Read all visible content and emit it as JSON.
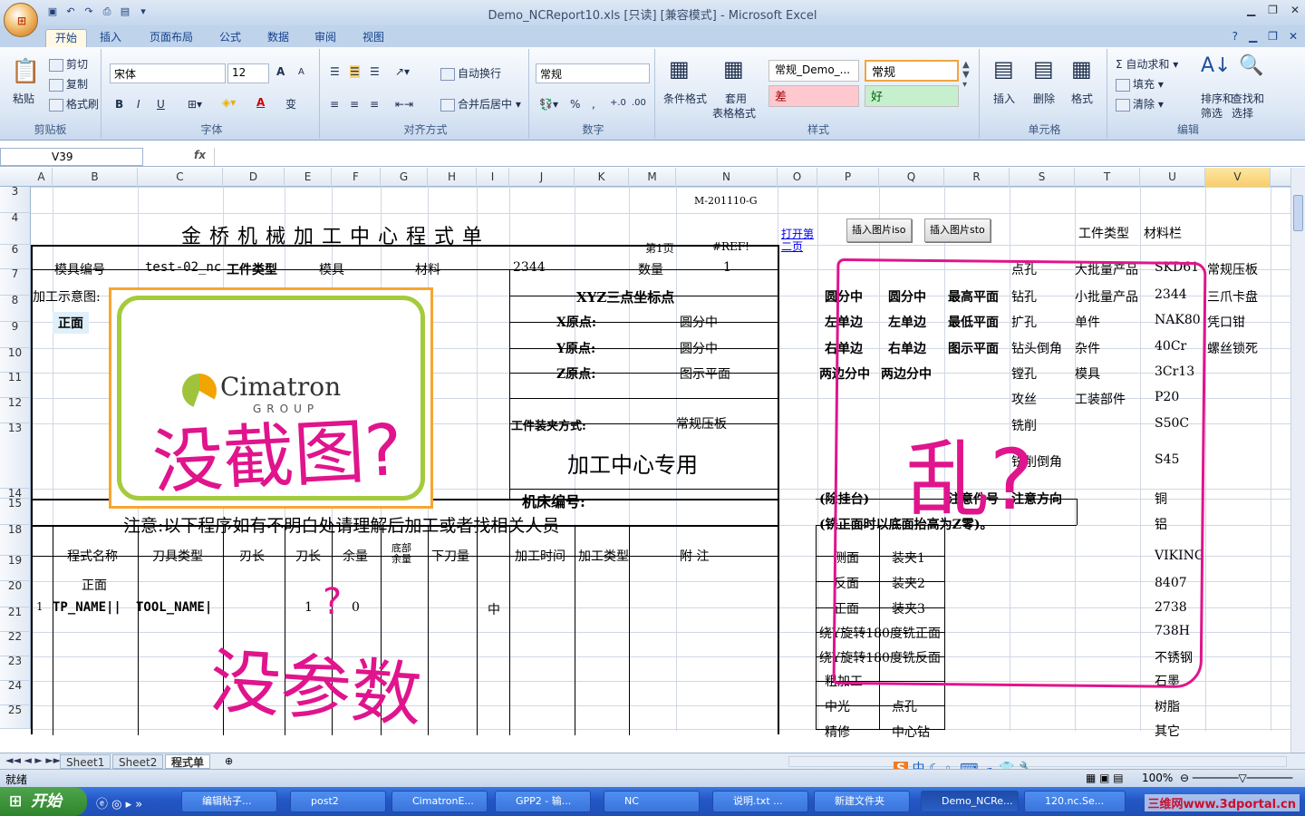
{
  "window": {
    "title": "Demo_NCReport10.xls  [只读]  [兼容模式] - Microsoft Excel",
    "office_button": "⊞"
  },
  "tabs": [
    "开始",
    "插入",
    "页面布局",
    "公式",
    "数据",
    "审阅",
    "视图"
  ],
  "ribbon": {
    "clipboard": {
      "label": "剪贴板",
      "paste": "粘贴",
      "cut": "剪切",
      "copy": "复制",
      "format_painter": "格式刷"
    },
    "font": {
      "label": "字体",
      "family": "宋体",
      "size": "12",
      "bold": "B",
      "italic": "I",
      "underline": "U",
      "grow": "A",
      "shrink": "A",
      "fontcolor": "A",
      "phonetic": "变"
    },
    "align": {
      "label": "对齐方式",
      "wrap": "自动换行",
      "merge": "合并后居中"
    },
    "number": {
      "label": "数字",
      "format": "常规",
      "percent": "%",
      "comma": ",",
      "inc": "+.0",
      "dec": ".00"
    },
    "styles": {
      "label": "样式",
      "cond": "条件格式",
      "table_fmt": "套用",
      "table_fmt2": "表格格式",
      "normal_demo": "常规_Demo_...",
      "normal": "常规",
      "bad": "差",
      "good": "好"
    },
    "cells": {
      "label": "单元格",
      "insert": "插入",
      "delete": "删除",
      "format": "格式"
    },
    "editing": {
      "label": "编辑",
      "autosum": "自动求和",
      "fill": "填充",
      "clear": "清除",
      "sort": "排序和",
      "sort2": "筛选",
      "find": "查找和",
      "find2": "选择"
    }
  },
  "formula_bar": {
    "namebox": "V39",
    "fx": "fx",
    "value": ""
  },
  "columns": [
    "A",
    "B",
    "C",
    "D",
    "E",
    "F",
    "G",
    "H",
    "I",
    "J",
    "K",
    "M",
    "N",
    "O",
    "P",
    "Q",
    "R",
    "S",
    "T",
    "U",
    "V"
  ],
  "rows": [
    "3",
    "4",
    "6",
    "7",
    "8",
    "9",
    "10",
    "11",
    "12",
    "13",
    "14",
    "15",
    "18",
    "19",
    "20",
    "21",
    "22",
    "23",
    "24",
    "25"
  ],
  "sheet": {
    "code": "M-201110-G",
    "title": "金 桥 机 械 加 工 中 心 程 式 单",
    "page": "第1页",
    "ref": "#REF!",
    "open_page2": "打开第二页",
    "insert_iso": "插入图片iso",
    "insert_sto": "插入图片sto",
    "part_type_header": "工件类型",
    "material_header": "材料栏",
    "mold_no": "模具编号",
    "mold_no_val": "test-02_nc",
    "part_type": "工件类型",
    "part_type_val": "模具",
    "material": "材料",
    "material_val": "2344",
    "qty": "数量",
    "qty_val": "1",
    "diagram": "加工示意图:",
    "front": "正面",
    "xyz": "XYZ三点坐标点",
    "x_origin": "X原点:",
    "x_val": "圆分中",
    "y_origin": "Y原点:",
    "y_val": "圆分中",
    "z_origin": "Z原点:",
    "z_val": "图示平面",
    "clamp": "工件装夹方式:",
    "clamp_val": "常规压板",
    "center_only": "加工中心专用",
    "machine_no": "机床编号:",
    "notice": "注意:以下程序如有不明白处请理解后加工或者找相关人员",
    "cols_hdr": [
      "程式名称",
      "刀具类型",
      "刃长",
      "刀长",
      "余量",
      "底部余量",
      "下刀量",
      "",
      "加工时间",
      "加工类型",
      "附    注"
    ],
    "row19_front": "正面",
    "row20": {
      "no": "1",
      "name": "TP_NAME||",
      "tool": "TOOL_NAME|",
      "len": "1",
      "stock": "0",
      "mid": "中"
    },
    "logo_main": "Cimatron",
    "logo_sub": "GROUP",
    "list_p": [
      "圆分中",
      "左单边",
      "右单边",
      "两边分中"
    ],
    "list_q": [
      "圆分中",
      "左单边",
      "右单边",
      "两边分中"
    ],
    "list_r": [
      "最高平面",
      "最低平面",
      "图示平面"
    ],
    "list_s": [
      "点孔",
      "钻孔",
      "扩孔",
      "钻头倒角",
      "镗孔",
      "攻丝",
      "铣削",
      "铣削倒角",
      "注意方向"
    ],
    "list_t": [
      "大批量产品",
      "小批量产品",
      "单件",
      "杂件",
      "模具",
      "工装部件"
    ],
    "list_u": [
      "SKD61",
      "2344",
      "NAK80",
      "40Cr",
      "3Cr13",
      "P20",
      "S50C",
      "S45",
      "铜",
      "铝",
      "VIKING",
      "8407",
      "2738",
      "738H",
      "不锈钢",
      "石墨",
      "树脂",
      "其它"
    ],
    "list_v": [
      "常规压板",
      "三爪卡盘",
      "凭口钳",
      "螺丝锁死"
    ],
    "except": "(除挂台)",
    "note_part": "注意件号",
    "front_note": "(铣正面时以底面抬高为Z零)。",
    "side_a": [
      "侧面",
      "反面",
      "正面"
    ],
    "side_b": [
      "装夹1",
      "装夹2",
      "装夹3"
    ],
    "rot1": "绕Y旋转180度铣正面",
    "rot2": "绕Y旋转180度铣反面",
    "ops_a": [
      "粗加工",
      "中光",
      "精修"
    ],
    "ops_b": [
      "",
      "点孔",
      "中心钻"
    ]
  },
  "annotations": {
    "no_screenshot": "没截图?",
    "mess": "乱?",
    "no_param": "没参数",
    "q": "?"
  },
  "sheet_tabs": [
    "Sheet1",
    "Sheet2",
    "程式单"
  ],
  "status": {
    "ready": "就绪",
    "zoom": "100%"
  },
  "ime": "中",
  "taskbar": {
    "start": "开始",
    "items": [
      "编辑帖子...",
      "post2",
      "CimatronE...",
      "GPP2 - 输...",
      "NC",
      "说明.txt ...",
      "新建文件夹",
      "Demo_NCRe...",
      "120.nc.Se..."
    ],
    "watermark": "三维网www.3dportal.cn"
  }
}
